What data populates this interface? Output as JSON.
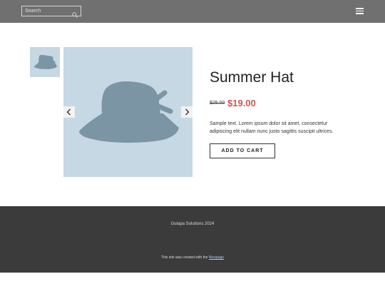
{
  "header": {
    "search_placeholder": "Search",
    "search_icon": "magnifier",
    "menu_icon": "hamburger"
  },
  "product": {
    "title": "Summer Hat",
    "old_price": "$25.00",
    "price": "$19.00",
    "description": "Sample text. Lorem ipsum dolor sit amet, consectetur adipiscing elit nullam nunc justo sagittis suscipit ultrices.",
    "add_to_cart_label": "ADD TO CART",
    "image_icon": "hat",
    "prev_icon": "chevron-left",
    "next_icon": "chevron-right"
  },
  "footer": {
    "copyright": "Gulapa Solutions 2024",
    "credit_prefix": "This site was created with the ",
    "credit_link": "Nicepage"
  },
  "colors": {
    "header_bg": "#707070",
    "image_bg": "#c6d8e3",
    "hat": "#7b95a5",
    "price": "#d9534f",
    "footer_bg": "#3b3b3b"
  }
}
